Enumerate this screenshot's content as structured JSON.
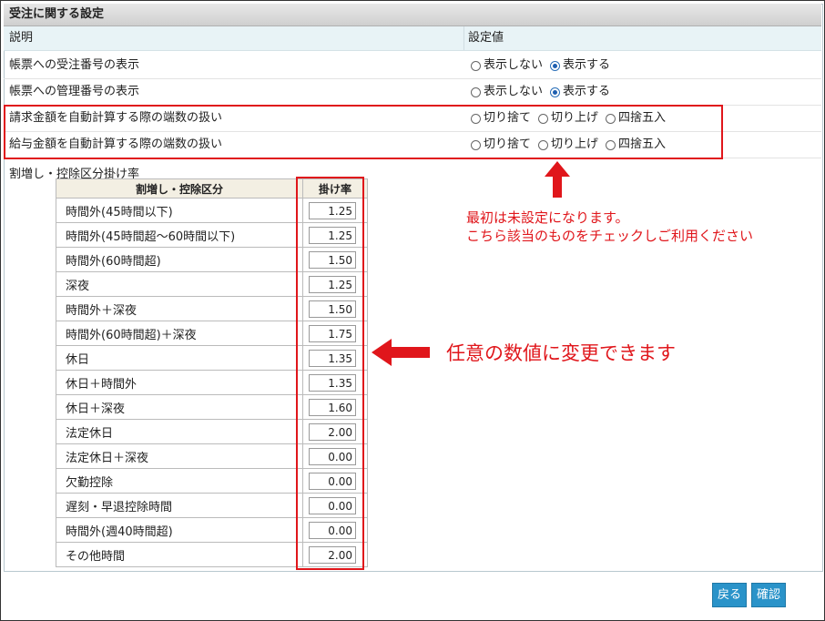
{
  "title": "受注に関する設定",
  "header": {
    "description": "説明",
    "setting_value": "設定値"
  },
  "rows": [
    {
      "label": "帳票への受注番号の表示",
      "options": [
        {
          "label": "表示しない",
          "selected": false
        },
        {
          "label": "表示する",
          "selected": true
        }
      ]
    },
    {
      "label": "帳票への管理番号の表示",
      "options": [
        {
          "label": "表示しない",
          "selected": false
        },
        {
          "label": "表示する",
          "selected": true
        }
      ]
    },
    {
      "label": "請求金額を自動計算する際の端数の扱い",
      "options": [
        {
          "label": "切り捨て",
          "selected": false
        },
        {
          "label": "切り上げ",
          "selected": false
        },
        {
          "label": "四捨五入",
          "selected": false
        }
      ]
    },
    {
      "label": "給与金額を自動計算する際の端数の扱い",
      "options": [
        {
          "label": "切り捨て",
          "selected": false
        },
        {
          "label": "切り上げ",
          "selected": false
        },
        {
          "label": "四捨五入",
          "selected": false
        }
      ]
    }
  ],
  "rates_label": "割増し・控除区分掛け率",
  "rates_table": {
    "headers": [
      "割増し・控除区分",
      "掛け率"
    ],
    "rows": [
      {
        "name": "時間外(45時間以下)",
        "rate": "1.25"
      },
      {
        "name": "時間外(45時間超～60時間以下)",
        "rate": "1.25"
      },
      {
        "name": "時間外(60時間超)",
        "rate": "1.50"
      },
      {
        "name": "深夜",
        "rate": "1.25"
      },
      {
        "name": "時間外＋深夜",
        "rate": "1.50"
      },
      {
        "name": "時間外(60時間超)＋深夜",
        "rate": "1.75"
      },
      {
        "name": "休日",
        "rate": "1.35"
      },
      {
        "name": "休日＋時間外",
        "rate": "1.35"
      },
      {
        "name": "休日＋深夜",
        "rate": "1.60"
      },
      {
        "name": "法定休日",
        "rate": "2.00"
      },
      {
        "name": "法定休日＋深夜",
        "rate": "0.00"
      },
      {
        "name": "欠勤控除",
        "rate": "0.00"
      },
      {
        "name": "遅刻・早退控除時間",
        "rate": "0.00"
      },
      {
        "name": "時間外(週40時間超)",
        "rate": "0.00"
      },
      {
        "name": "その他時間",
        "rate": "2.00"
      }
    ]
  },
  "annotations": {
    "note_radio_line1": "最初は未設定になります。",
    "note_radio_line2": "こちら該当のものをチェックしご利用ください",
    "note_rates": "任意の数値に変更できます"
  },
  "buttons": {
    "back": "戻る",
    "confirm": "確認"
  },
  "colors": {
    "annotation_red": "#e0161b",
    "button_blue": "#2a93c9",
    "header_bg": "#e8f3f6"
  }
}
